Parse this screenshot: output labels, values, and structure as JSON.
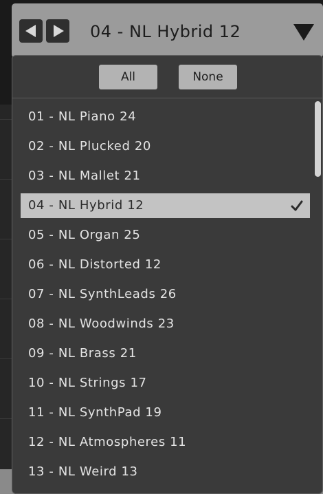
{
  "header": {
    "title": "04 - NL Hybrid 12",
    "prev_icon": "triangle-left",
    "next_icon": "triangle-right",
    "dropdown_icon": "triangle-down"
  },
  "toolbar": {
    "all_label": "All",
    "none_label": "None"
  },
  "list": {
    "items": [
      {
        "label": "01 - NL Piano 24"
      },
      {
        "label": "02 - NL Plucked 20"
      },
      {
        "label": "03 - NL Mallet 21"
      },
      {
        "label": "04 - NL Hybrid 12",
        "selected": true
      },
      {
        "label": "05 - NL Organ 25"
      },
      {
        "label": "06 - NL Distorted 12"
      },
      {
        "label": "07 - NL SynthLeads 26"
      },
      {
        "label": "08 - NL Woodwinds 23"
      },
      {
        "label": "09 - NL Brass 21"
      },
      {
        "label": "10 - NL Strings 17"
      },
      {
        "label": "11 - NL SynthPad 19"
      },
      {
        "label": "12 - NL Atmospheres 11"
      },
      {
        "label": "13 - NL Weird 13"
      }
    ],
    "check_icon": "checkmark"
  },
  "colors": {
    "header_bg": "#9b9b9b",
    "panel_bg": "#3a3a3a",
    "selected_bg": "#c3c3c3",
    "button_bg": "#b3b3b3"
  }
}
